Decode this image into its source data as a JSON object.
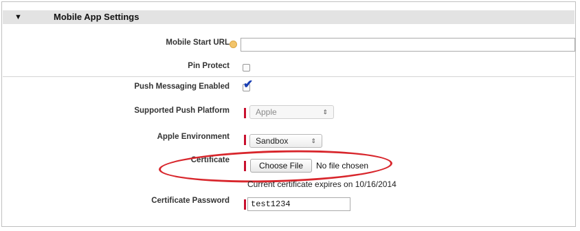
{
  "section": {
    "title": "Mobile App Settings",
    "toggle_icon": "triangle-down-icon"
  },
  "fields": {
    "mobile_start_url": {
      "label": "Mobile Start URL",
      "value": "",
      "info_icon": "info-icon"
    },
    "pin_protect": {
      "label": "Pin Protect",
      "checked": false
    },
    "push_messaging": {
      "label": "Push Messaging Enabled",
      "checked": true
    },
    "push_platform": {
      "label": "Supported Push Platform",
      "value": "Apple",
      "disabled": true
    },
    "apple_environment": {
      "label": "Apple Environment",
      "value": "Sandbox"
    },
    "certificate": {
      "label": "Certificate",
      "button_label": "Choose File",
      "file_status": "No file chosen",
      "expiry_note": "Current certificate expires on 10/16/2014"
    },
    "certificate_password": {
      "label": "Certificate Password",
      "value": "test1234"
    }
  },
  "colors": {
    "header_bg": "#e3e3e3",
    "required_marker": "#c8102e",
    "highlight_ellipse": "#d8262c",
    "checkmark": "#1a3fb3"
  }
}
